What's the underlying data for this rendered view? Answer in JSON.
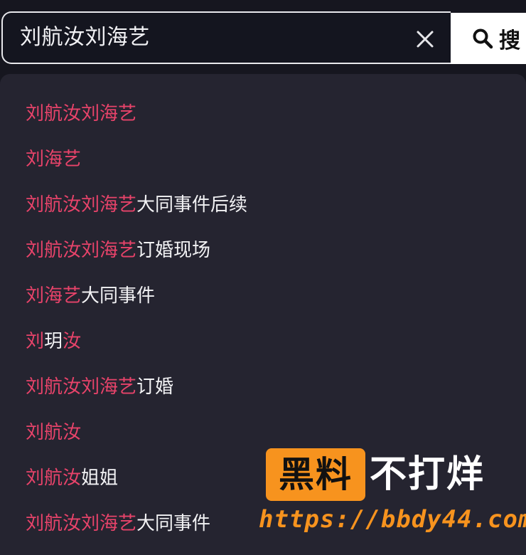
{
  "search": {
    "query": "刘航汝刘海艺",
    "button_label": "搜",
    "clear_icon": "close-icon",
    "search_icon": "magnifier-icon"
  },
  "colors": {
    "highlight": "#e8436a",
    "text": "#f2f2f4",
    "dropdown_bg": "#252430",
    "watermark_orange": "#f7931e"
  },
  "suggestions": [
    {
      "highlight": "刘航汝刘海艺",
      "rest": ""
    },
    {
      "highlight": "刘海艺",
      "rest": ""
    },
    {
      "highlight": "刘航汝刘海艺",
      "rest": "大同事件后续"
    },
    {
      "highlight": "刘航汝刘海艺",
      "rest": "订婚现场"
    },
    {
      "highlight": "刘海艺",
      "rest": "大同事件"
    },
    {
      "highlight": "刘",
      "rest": "玥",
      "highlight2": "汝"
    },
    {
      "highlight": "刘航汝刘海艺",
      "rest": "订婚"
    },
    {
      "highlight": "刘航汝",
      "rest": ""
    },
    {
      "highlight": "刘航汝",
      "rest": "姐姐"
    },
    {
      "highlight": "刘航汝刘海艺",
      "rest": "大同事件"
    }
  ],
  "watermark": {
    "brand_boxed": "黑料",
    "brand_plain": "不打烊",
    "url": "https://bbdy44.com"
  }
}
